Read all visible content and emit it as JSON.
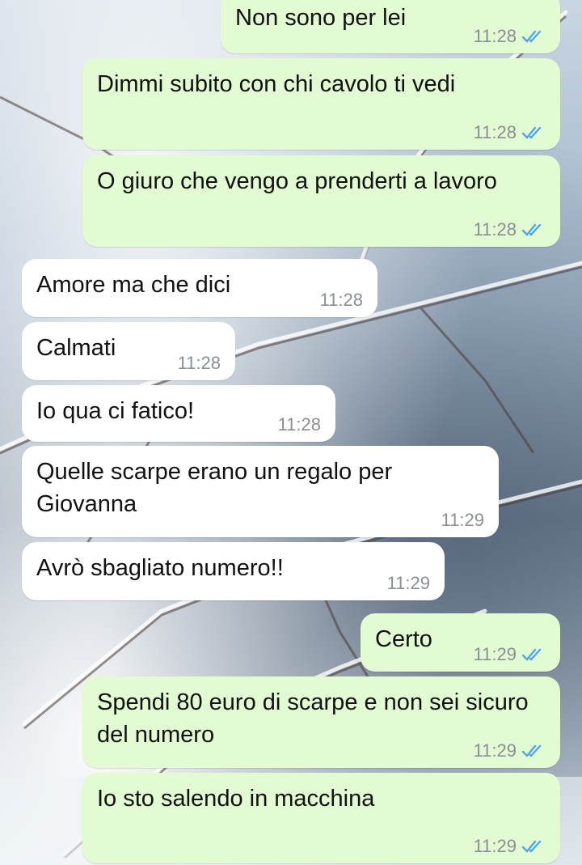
{
  "theme": {
    "outgoing_bubble": "#e2fbd3",
    "incoming_bubble": "#ffffff",
    "time_color": "#8a8f93",
    "read_tick_color": "#4fa6e8"
  },
  "messages": [
    {
      "direction": "out",
      "text": "Non sono per lei",
      "time": "11:28",
      "status": "read-ticks-icon"
    },
    {
      "direction": "out",
      "text": "Dimmi subito con chi cavolo ti vedi",
      "time": "11:28",
      "status": "read-ticks-icon"
    },
    {
      "direction": "out",
      "text": "O giuro che vengo a prenderti a lavoro",
      "time": "11:28",
      "status": "read-ticks-icon"
    },
    {
      "direction": "in",
      "text": "Amore ma che dici",
      "time": "11:28"
    },
    {
      "direction": "in",
      "text": "Calmati",
      "time": "11:28"
    },
    {
      "direction": "in",
      "text": "Io qua ci fatico!",
      "time": "11:28"
    },
    {
      "direction": "in",
      "text": "Quelle scarpe erano un regalo per Giovanna",
      "time": "11:29"
    },
    {
      "direction": "in",
      "text": "Avrò sbagliato numero!!",
      "time": "11:29"
    },
    {
      "direction": "out",
      "text": "Certo",
      "time": "11:29",
      "status": "read-ticks-icon"
    },
    {
      "direction": "out",
      "text": "Spendi 80 euro di scarpe e non sei sicuro del numero",
      "time": "11:29",
      "status": "read-ticks-icon"
    },
    {
      "direction": "out",
      "text": "Io sto salendo in macchina",
      "time": "11:29",
      "status": "read-ticks-icon"
    }
  ]
}
